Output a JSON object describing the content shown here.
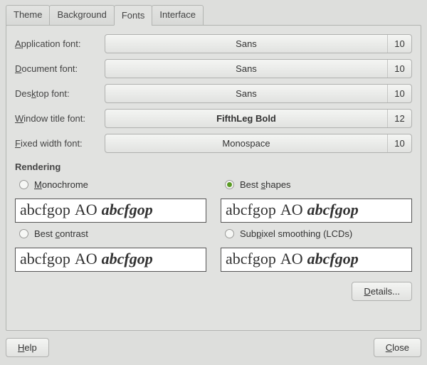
{
  "tabs": [
    "Theme",
    "Background",
    "Fonts",
    "Interface"
  ],
  "activeTab": 2,
  "fontRows": [
    {
      "label_pre": "",
      "label_u": "A",
      "label_post": "pplication font:",
      "name": "Sans",
      "size": "10"
    },
    {
      "label_pre": "",
      "label_u": "D",
      "label_post": "ocument font:",
      "name": "Sans",
      "size": "10"
    },
    {
      "label_pre": "Des",
      "label_u": "k",
      "label_post": "top font:",
      "name": "Sans",
      "size": "10"
    },
    {
      "label_pre": "",
      "label_u": "W",
      "label_post": "indow title font:",
      "name": "FifthLeg Bold",
      "size": "12",
      "bold": true
    },
    {
      "label_pre": "",
      "label_u": "F",
      "label_post": "ixed width font:",
      "name": "Monospace",
      "size": "10"
    }
  ],
  "rendering": {
    "title": "Rendering",
    "options": [
      {
        "pre": "",
        "u": "M",
        "post": "onochrome",
        "selected": false
      },
      {
        "pre": "Best ",
        "u": "s",
        "post": "hapes",
        "selected": true
      },
      {
        "pre": "Best ",
        "u": "c",
        "post": "ontrast",
        "selected": false
      },
      {
        "pre": "Sub",
        "u": "p",
        "post": "ixel smoothing (LCDs)",
        "selected": false
      }
    ],
    "sample_reg": "abcfgop",
    "sample_caps": "AO",
    "sample_ital": "abcfgop"
  },
  "buttons": {
    "details": "D",
    "details_post": "etails...",
    "help": "H",
    "help_post": "elp",
    "close": "C",
    "close_post": "lose"
  }
}
